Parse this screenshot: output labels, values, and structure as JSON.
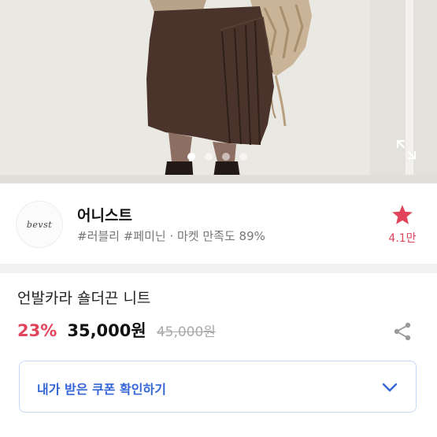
{
  "gallery": {
    "total_images": 4,
    "active_index": 0
  },
  "seller": {
    "logo_text": "bevst",
    "name": "어니스트",
    "tags": "#러블리 #페미닌 · 마켓 만족도 89%",
    "favorite_count": "4.1만"
  },
  "product": {
    "title": "언발카라 숄더끈 니트",
    "discount": "23%",
    "price": "35,000원",
    "original_price": "45,000원"
  },
  "coupon": {
    "label": "내가 받은 쿠폰 확인하기"
  },
  "colors": {
    "accent_pink": "#e0455b",
    "accent_blue": "#3566d8",
    "coupon_border": "#c9d7f7"
  }
}
